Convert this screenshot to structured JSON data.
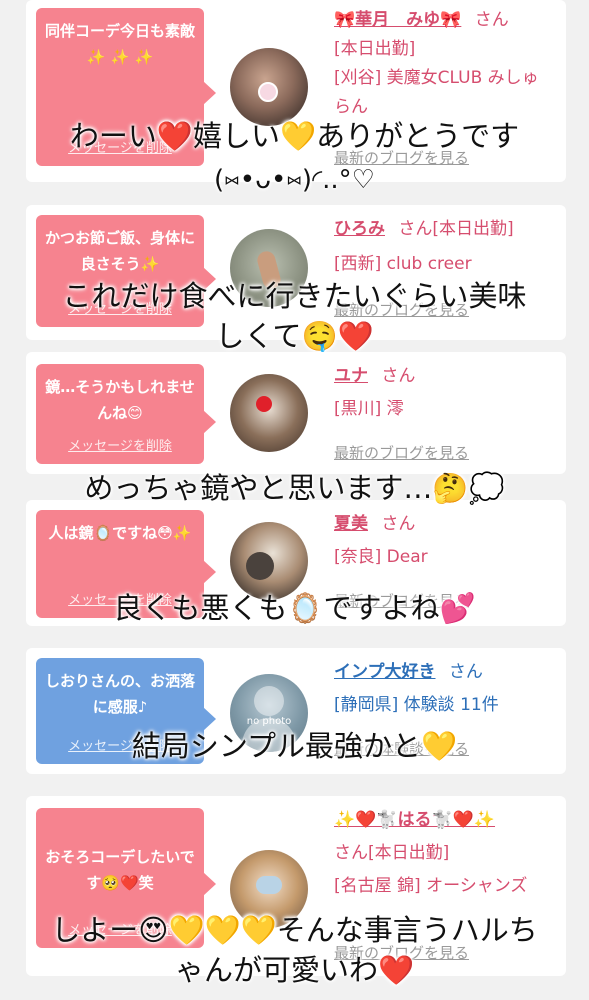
{
  "cards": [
    {
      "bubble_text": "同伴コーデ今日も素敵✨ ✨ ✨",
      "delete_label": "メッセージを削除",
      "name": "🎀華月　みゆ🎀",
      "san": "さん",
      "line2": "[本日出勤]",
      "line3": "[刈谷] 美魔女CLUB みしゅらん",
      "blog": "最新のブログを見る"
    },
    {
      "bubble_text": "かつお節ご飯、身体に良さそう✨",
      "delete_label": "メッセージを削除",
      "name": "ひろみ",
      "san": "さん[本日出勤]",
      "line2": "[西新] club creer",
      "line3": "",
      "blog": "最新のブログを見る"
    },
    {
      "bubble_text": "鏡…そうかもしれませんね😊",
      "delete_label": "メッセージを削除",
      "name": "ユナ",
      "san": "さん",
      "line2": "[黒川] 澪",
      "line3": "",
      "blog": "最新のブログを見る"
    },
    {
      "bubble_text": "人は鏡🪞ですね😳✨",
      "delete_label": "メッセージを削除",
      "name": "夏美",
      "san": "さん",
      "line2": "[奈良] Dear",
      "line3": "",
      "blog": "最新のブログを見る"
    },
    {
      "bubble_text": "しおりさんの、お洒落に感服♪",
      "delete_label": "メッセージを削除",
      "name": "インプ大好き",
      "san": "さん",
      "line2": "[静岡県] 体験談 11件",
      "line3": "",
      "blog": "最新の体験談を見る"
    },
    {
      "bubble_text": "おそろコーデしたいです🥺❤️笑",
      "delete_label": "メッセージを削除",
      "name": "✨❤️🐩はる🐩❤️✨",
      "san": "さん[本日出勤]",
      "line2": "[名古屋 錦] オーシャンズ",
      "line3": "",
      "blog": "最新のブログを見る"
    }
  ],
  "overlays": [
    "わーい❤️嬉しい💛ありがとうです",
    "(⑅•ᴗ•⑅)◜..°♡",
    "これだけ食べに行きたいぐらい美味",
    "しくて🤤❤️",
    "めっちゃ鏡やと思います…🤔💭",
    "良くも悪くも🪞ですよね💕",
    "結局シンプル最強かと💛",
    "しよー😍💛💛💛そんな事言うハルち",
    "ゃんが可愛いわ❤️"
  ],
  "avatar_watermark": "no photo",
  "colors": {
    "background": "#f1f1f1",
    "pink_bubble": "#f6838f",
    "blue_bubble": "#6fa1e0",
    "name_pink": "#d64d6e",
    "name_blue": "#2d6fb8"
  }
}
